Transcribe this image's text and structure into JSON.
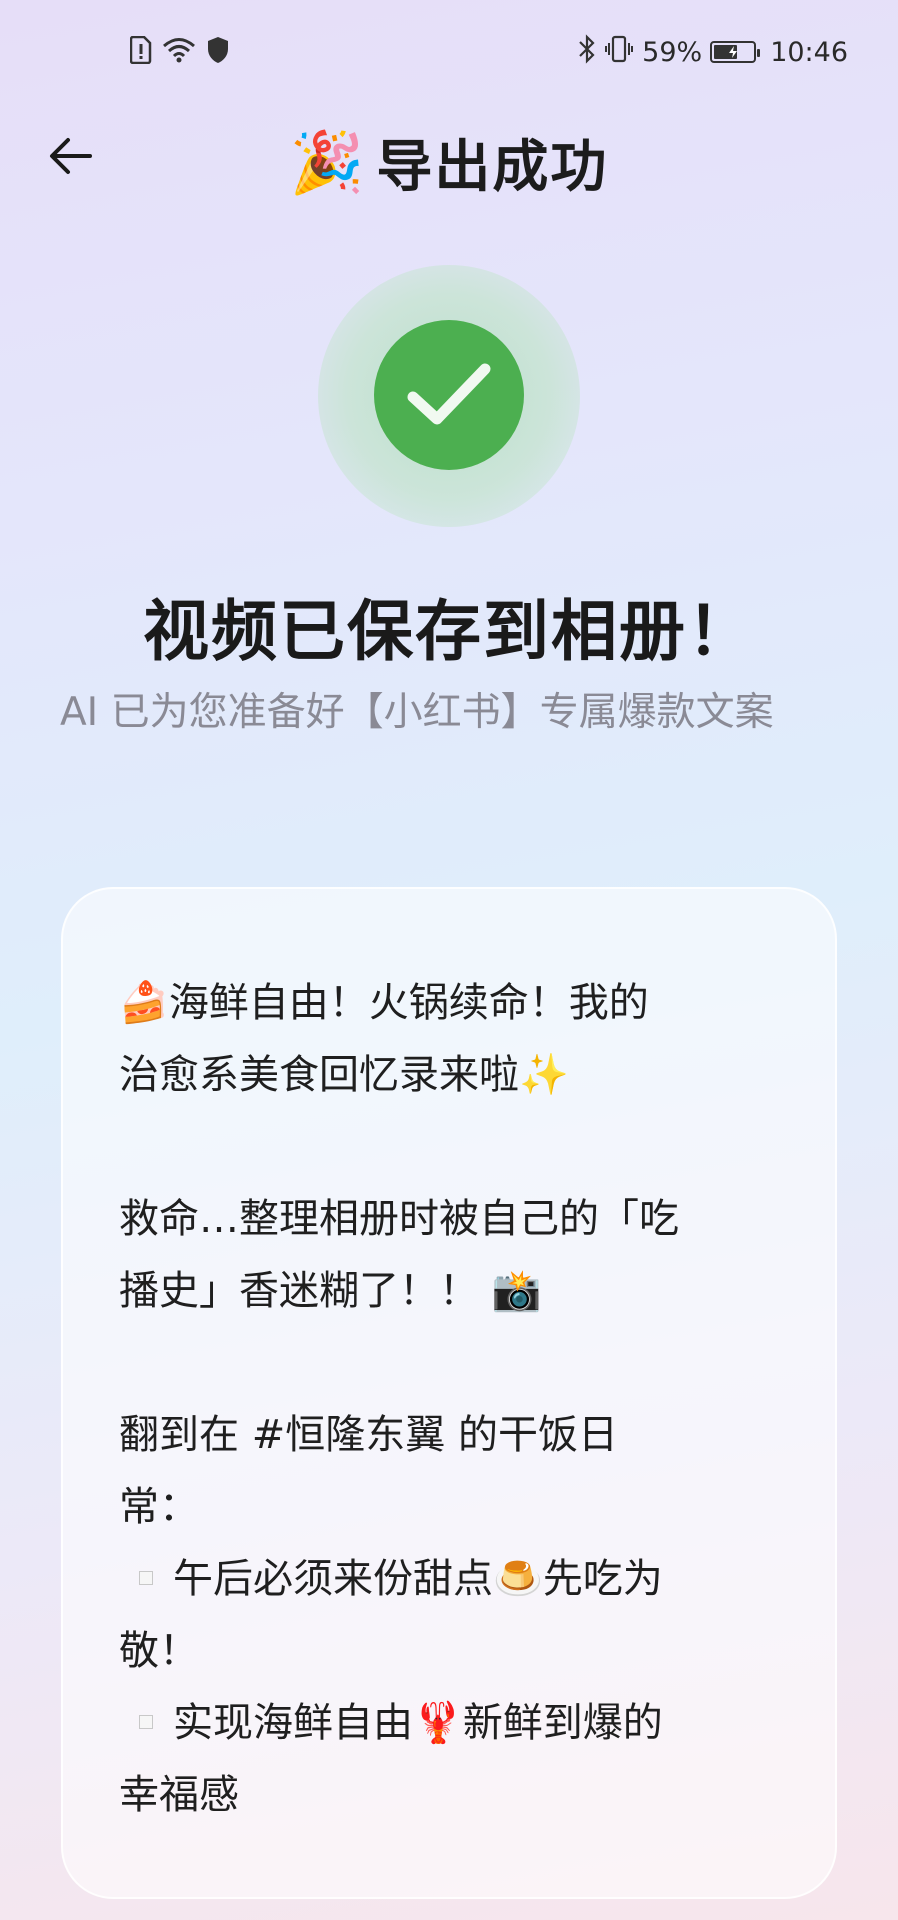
{
  "status_bar": {
    "battery_percent": "59%",
    "battery_level": 0.59,
    "time": "10:46",
    "left_icons": [
      "sim-alert-icon",
      "wifi-icon",
      "shield-icon"
    ],
    "right_icons": [
      "bluetooth-icon",
      "vibrate-icon",
      "battery-icon"
    ]
  },
  "header": {
    "back_icon": "back-arrow-icon",
    "title_emoji": "🎉",
    "title": "导出成功"
  },
  "success": {
    "icon": "checkmark-icon",
    "accent_color": "#4caf50",
    "heading": "视频已保存到相册！",
    "subtext": "AI 已为您准备好【小红书】专属爆款文案"
  },
  "caption": {
    "line1_emoji": "🍰",
    "line1_text": "海鲜自由！火锅续命！我的",
    "line2_text": "治愈系美食回忆录来啦",
    "line2_emoji": "✨",
    "line3_text": "救命…整理相册时被自己的「吃",
    "line4_text": "播史」香迷糊了！！",
    "line4_emoji": "📸",
    "line5_text": "翻到在 #恒隆东翼 的干饭日",
    "line6_text": "常：",
    "line7_text": "午后必须来份甜点",
    "line7_emoji": "🍮",
    "line7_text_after": "先吃为",
    "line8_text": "敬！",
    "line9_text": "实现海鲜自由",
    "line9_emoji": "🦞",
    "line9_text_after": "新鲜到爆的",
    "line10_text": "幸福感"
  }
}
